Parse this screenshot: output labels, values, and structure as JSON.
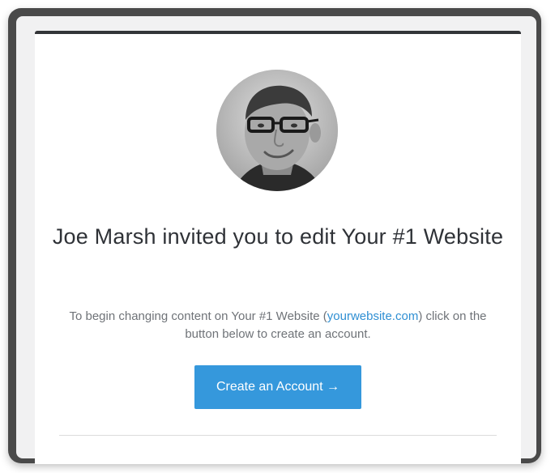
{
  "invite": {
    "title": "Joe Marsh invited you to edit Your #1 Website",
    "body_prefix": "To begin changing content on Your #1 Website (",
    "body_link": "yourwebsite.com",
    "body_suffix": ") click on the button below to create an account.",
    "cta_label": "Create an Account →"
  },
  "colors": {
    "accent": "#3598dc",
    "link": "#2f8fd3",
    "top_bar": "#333538",
    "title_text": "#2f3237",
    "body_text": "#6f7378"
  },
  "icons": {
    "avatar": "profile-photo"
  }
}
